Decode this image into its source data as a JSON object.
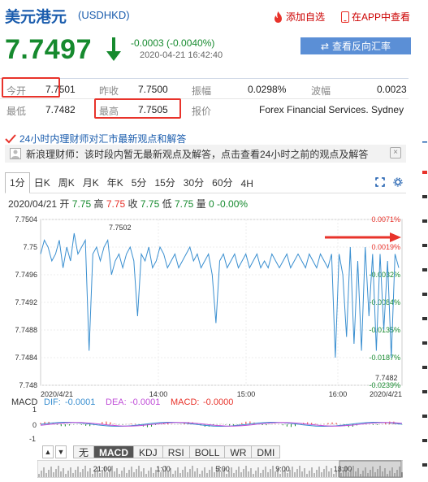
{
  "header": {
    "name": "美元港元",
    "code": "(USDHKD)",
    "add_watch_label": "添加自选",
    "open_app_label": "在APP中查看"
  },
  "quote": {
    "price": "7.7497",
    "change": "-0.0003 (-0.0040%)",
    "datetime": "2020-04-21 16:42:40",
    "reverse_button_label": "查看反向汇率"
  },
  "stats": {
    "open_label": "今开",
    "open_value": "7.7501",
    "prev_close_label": "昨收",
    "prev_close_value": "7.7500",
    "amplitude_label": "振幅",
    "amplitude_value": "0.0298%",
    "volatility_label": "波幅",
    "volatility_value": "0.0023",
    "low_label": "最低",
    "low_value": "7.7482",
    "high_label": "最高",
    "high_value": "7.7505",
    "quote_label": "报价",
    "quote_value": "Forex Financial Services. Sydney"
  },
  "info_bar": {
    "text": "24小时内理财师对汇市最新观点和解答"
  },
  "notice": {
    "text": "新浪理财师：该时段内暂无最新观点及解答，点击查看24小时之前的观点及解答"
  },
  "tabs": [
    "1分",
    "日K",
    "周K",
    "月K",
    "年K",
    "5分",
    "15分",
    "30分",
    "60分",
    "4H"
  ],
  "active_tab": "1分",
  "ohlc": {
    "date": "2020/04/21",
    "open_label": "开",
    "open": "7.75",
    "high_label": "高",
    "high": "7.75",
    "close_label": "收",
    "close": "7.75",
    "low_label": "低",
    "low": "7.75",
    "volume_label": "量",
    "volume": "0",
    "change": "-0.00%"
  },
  "chart_data": {
    "type": "line",
    "y_ticks": [
      "7.7504",
      "7.75",
      "7.7496",
      "7.7492",
      "7.7488",
      "7.7484",
      "7.748"
    ],
    "y_range": [
      7.748,
      7.7504
    ],
    "right_pct_ticks": [
      "0.0071%",
      "0.0019%",
      "-0.0032%",
      "-0.0084%",
      "-0.0135%",
      "-0.0187%",
      "-0.0239%"
    ],
    "x_ticks": [
      "2020/4/21",
      "14:00",
      "15:00",
      "16:00",
      "2020/4/21"
    ],
    "annotations": [
      "7.7502",
      "7.7482"
    ],
    "series": [
      {
        "x_minutes": [
          0,
          5,
          10,
          15,
          20,
          25,
          30,
          35,
          40,
          45,
          50,
          55,
          60,
          65,
          70,
          75,
          80,
          85,
          90,
          95,
          100,
          105,
          110,
          115,
          120,
          125,
          130,
          135,
          140,
          145,
          150,
          155,
          160,
          165,
          170,
          175,
          180,
          185,
          190,
          195,
          200,
          205,
          210,
          215,
          220,
          225,
          230,
          235,
          240,
          245,
          250,
          255,
          260,
          265,
          270,
          275,
          280,
          285,
          290,
          295,
          300,
          305,
          310,
          315,
          320,
          325,
          330,
          335,
          340,
          345,
          350,
          355,
          360,
          365,
          370,
          375,
          380,
          385,
          390,
          395,
          400,
          405,
          410,
          415,
          420,
          425,
          430,
          435,
          440,
          445,
          450,
          455,
          460,
          465,
          470,
          475,
          480
        ],
        "values": [
          7.7499,
          7.7501,
          7.75,
          7.7498,
          7.7499,
          7.7501,
          7.7497,
          7.75,
          7.7498,
          7.7502,
          7.7499,
          7.75,
          7.7501,
          7.7485,
          7.7499,
          7.75,
          7.7498,
          7.75,
          7.7501,
          7.7496,
          7.7498,
          7.7499,
          7.7497,
          7.7499,
          7.75,
          7.7498,
          7.749,
          7.7499,
          7.7498,
          7.75,
          7.7497,
          7.7498,
          7.75,
          7.7499,
          7.7497,
          7.7498,
          7.7499,
          7.7497,
          7.7498,
          7.7499,
          7.75,
          7.7498,
          7.7499,
          7.7497,
          7.7498,
          7.7499,
          7.7496,
          7.7489,
          7.7498,
          7.7499,
          7.7497,
          7.7498,
          7.7499,
          7.7497,
          7.7498,
          7.7499,
          7.7497,
          7.7498,
          7.7499,
          7.7497,
          7.7498,
          7.7497,
          7.7499,
          7.7498,
          7.7497,
          7.7498,
          7.7499,
          7.7497,
          7.7498,
          7.7499,
          7.7498,
          7.7497,
          7.7499,
          7.7498,
          7.7497,
          7.7499,
          7.7498,
          7.7497,
          7.7499,
          7.7484,
          7.7499,
          7.7496,
          7.7487,
          7.75,
          7.7486,
          7.7498,
          7.7485,
          7.75,
          7.749,
          7.7499,
          7.7485,
          7.7499,
          7.7488,
          7.7498,
          7.7484,
          7.7499,
          7.7497
        ]
      }
    ]
  },
  "macd": {
    "label": "MACD",
    "dif_label": "DIF:",
    "dif": "-0.0001",
    "dea_label": "DEA:",
    "dea": "-0.0001",
    "macd_label": "MACD:",
    "macd_value": "-0.0000",
    "y_ticks": [
      "1",
      "0",
      "-1"
    ],
    "x_ticks": [
      "21:00",
      "1:00",
      "5:00",
      "9:00",
      "13:00"
    ]
  },
  "indicator_tabs": [
    "无",
    "MACD",
    "KDJ",
    "RSI",
    "BOLL",
    "WR",
    "DMI"
  ],
  "active_indicator": "MACD",
  "colors": {
    "up": "#e8332b",
    "down": "#168a2e",
    "link": "#1a5cad",
    "line": "#3a8fd0",
    "highlight": "#e8332b"
  }
}
